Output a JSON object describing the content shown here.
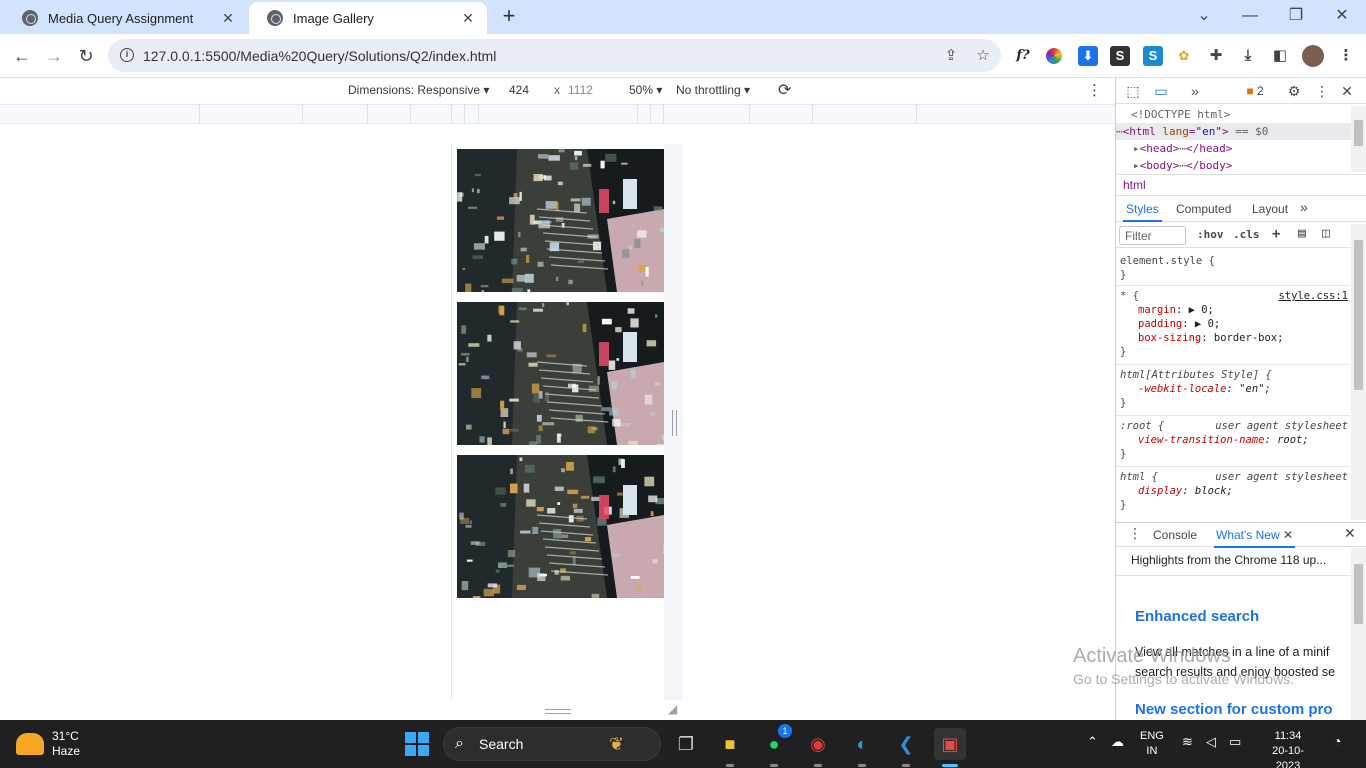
{
  "browser": {
    "tabs": [
      {
        "title": "Media Query Assignment",
        "active": false
      },
      {
        "title": "Image Gallery",
        "active": true
      }
    ],
    "new_tab_icon": "+",
    "window_controls": [
      "chevron-down",
      "minimize",
      "restore",
      "close"
    ],
    "url": "127.0.0.1:5500/Media%20Query/Solutions/Q2/index.html",
    "extensions": [
      {
        "name": "font-extension",
        "label": "f?"
      },
      {
        "name": "color-extension",
        "label": ""
      },
      {
        "name": "download-extension",
        "label": "⬇"
      },
      {
        "name": "s-extension",
        "label": "S"
      },
      {
        "name": "s2-extension",
        "label": "S"
      },
      {
        "name": "person-extension",
        "label": ""
      }
    ]
  },
  "device_toolbar": {
    "dimensions_label": "Dimensions: Responsive",
    "width": "424",
    "x": "x",
    "height": "1112",
    "zoom": "50%",
    "throttling": "No throttling"
  },
  "gallery": {
    "images": [
      {
        "alt": "city-night-aerial-1"
      },
      {
        "alt": "city-night-aerial-2"
      },
      {
        "alt": "city-night-aerial-3"
      }
    ]
  },
  "devtools": {
    "issues_count": "2",
    "elements": {
      "doctype": "<!DOCTYPE html>",
      "html_open": "<html",
      "html_attr": "lang",
      "html_attr_val": "\"en\"",
      "html_close": ">",
      "html_suffix": "== $0",
      "head_open": "<head>",
      "head_close": "</head>",
      "body_open": "<body>",
      "body_close": "</body>",
      "ellipsis": "⋯"
    },
    "breadcrumb": "html",
    "style_tabs": [
      "Styles",
      "Computed",
      "Layout"
    ],
    "filter_placeholder": "Filter",
    "hov": ":hov",
    "cls": ".cls",
    "rules": [
      {
        "selector": "element.style {",
        "close": "}"
      },
      {
        "selector": "* {",
        "source": "style.css:1",
        "props": [
          {
            "name": "margin",
            "value": "▶ 0;"
          },
          {
            "name": "padding",
            "value": "▶ 0;"
          },
          {
            "name": "box-sizing",
            "value": "border-box;"
          }
        ],
        "close": "}"
      },
      {
        "selector": "html[Attributes Style] {",
        "props": [
          {
            "name": "-webkit-locale",
            "value": "\"en\";"
          }
        ],
        "close": "}"
      },
      {
        "selector": ":root {",
        "source": "user agent stylesheet",
        "props": [
          {
            "name": "view-transition-name",
            "value": "root;"
          }
        ],
        "close": "}"
      },
      {
        "selector": "html {",
        "source": "user agent stylesheet",
        "props": [
          {
            "name": "display",
            "value": "block;"
          }
        ],
        "close": "}"
      }
    ],
    "drawer_tabs": [
      "Console",
      "What's New"
    ],
    "whats_new": {
      "highlight": "Highlights from the Chrome 118 up...",
      "heading1": "Enhanced search",
      "text1_line1": "View all matches in a line of a minif",
      "text1_line2": "search results and enjoy boosted se",
      "heading2": "New section for custom pro"
    }
  },
  "watermark": {
    "line1": "Activate Windows",
    "line2": "Go to Settings to activate Windows."
  },
  "taskbar": {
    "temperature": "31°C",
    "condition": "Haze",
    "search_label": "Search",
    "whatsapp_badge": "1",
    "language": "ENG",
    "region": "IN",
    "time": "11:34",
    "date": "20-10-2023"
  }
}
